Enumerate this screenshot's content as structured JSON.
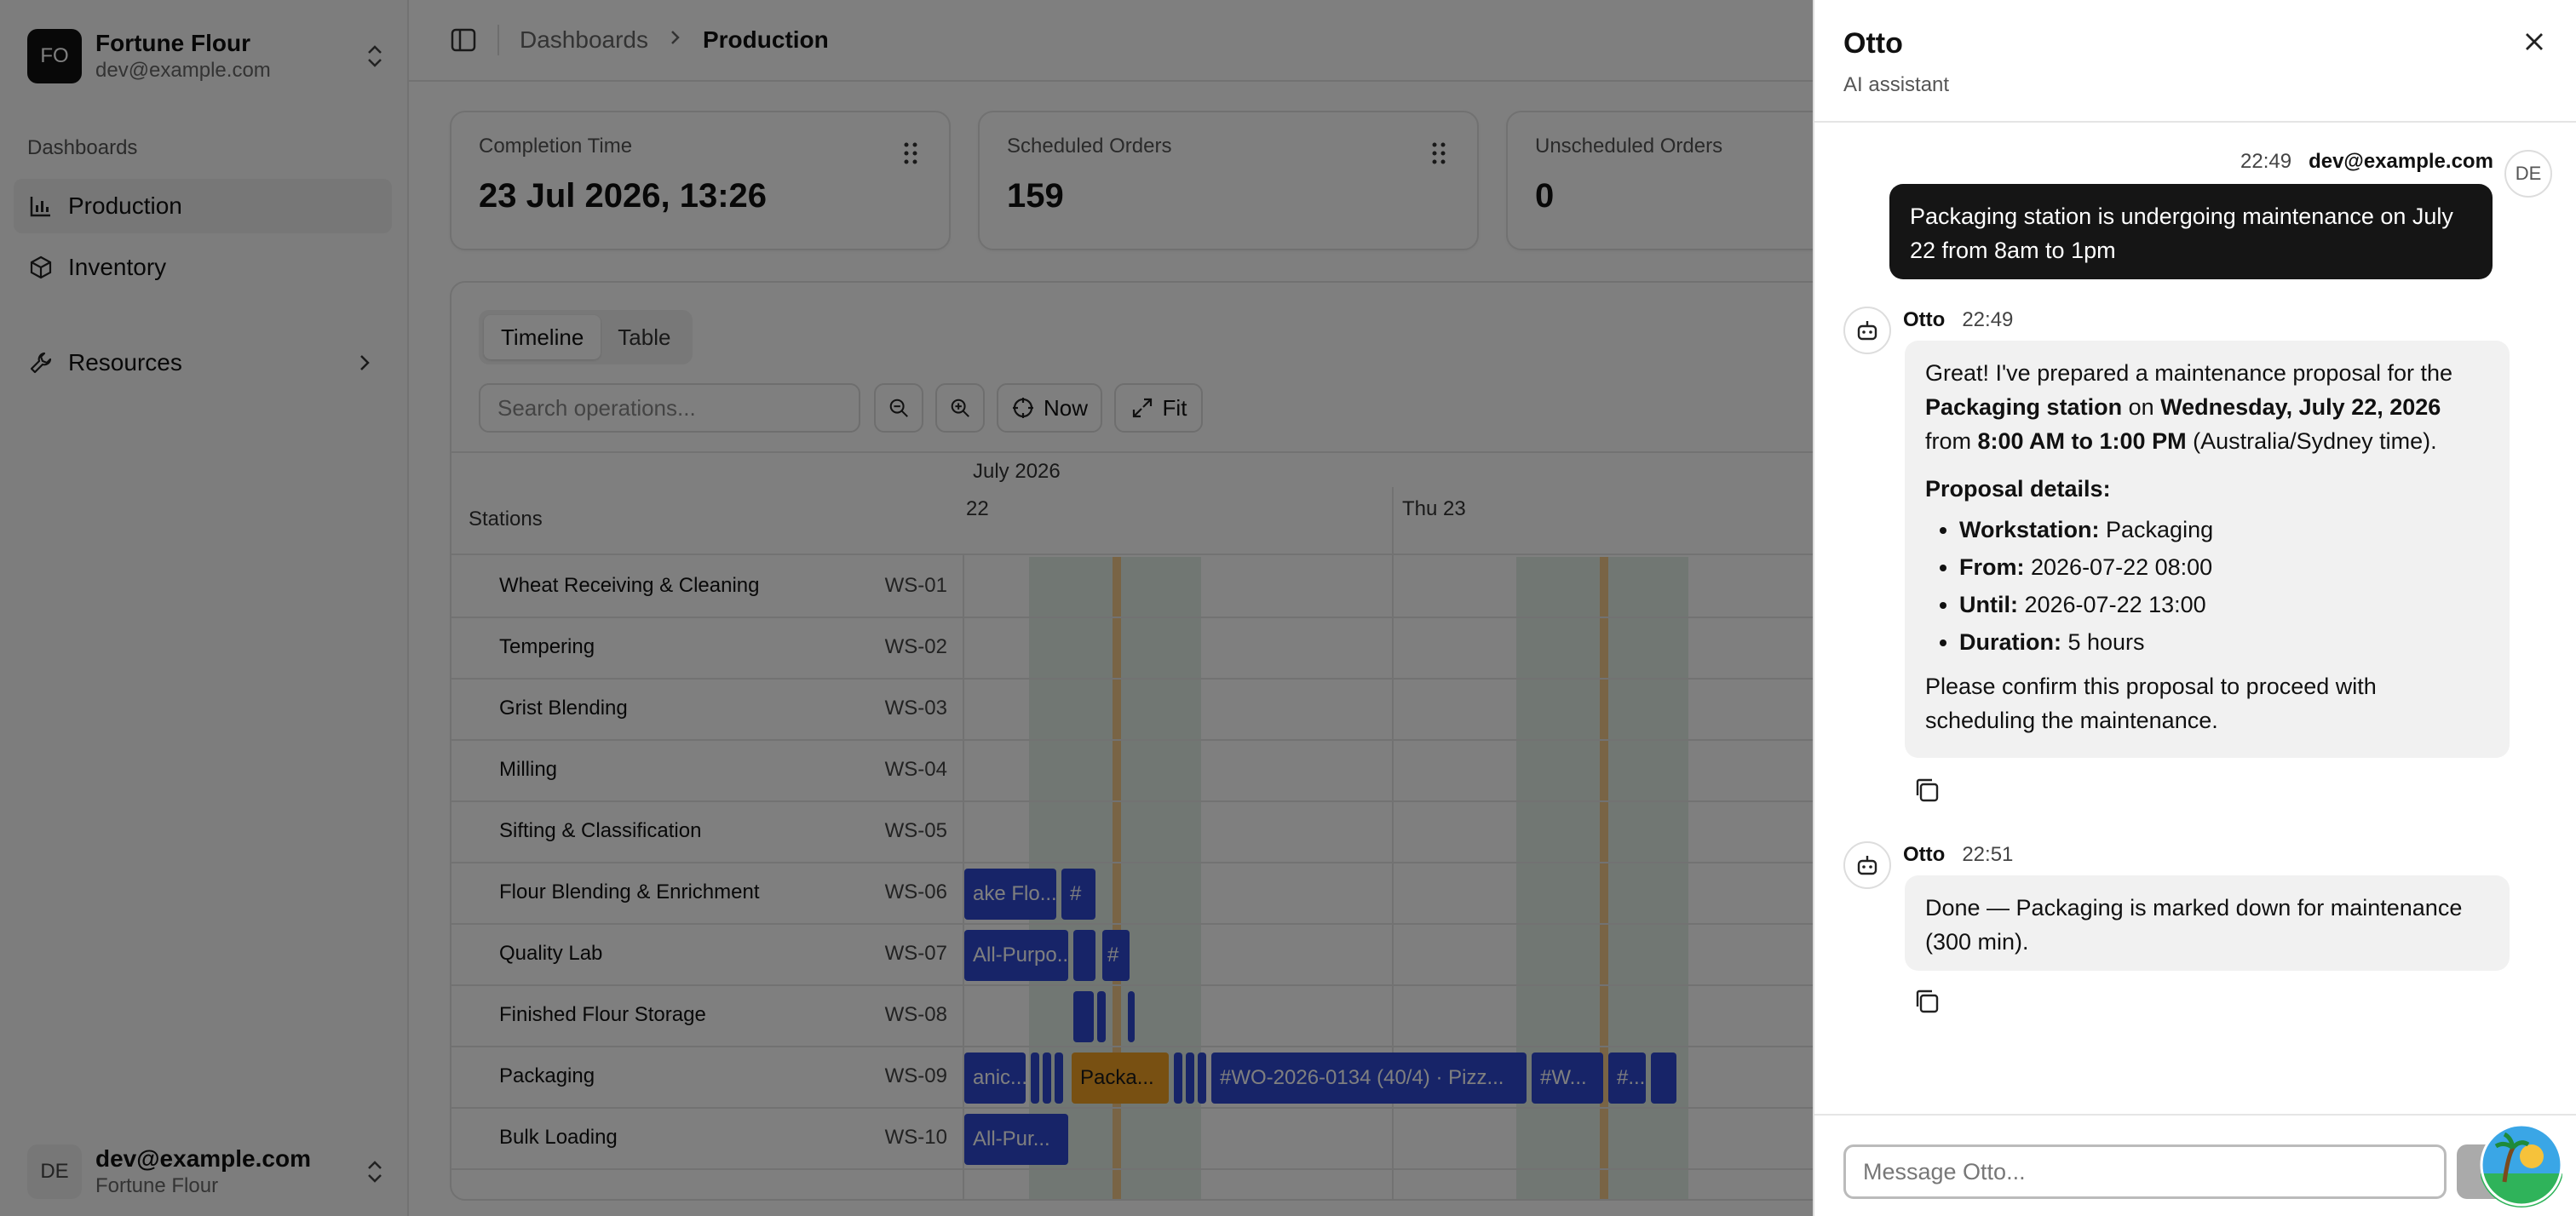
{
  "sidebar": {
    "team_initials": "FO",
    "team_name": "Fortune Flour",
    "team_email": "dev@example.com",
    "group_label": "Dashboards",
    "items": [
      {
        "label": "Production",
        "icon": "chart-icon",
        "active": true
      },
      {
        "label": "Inventory",
        "icon": "package-icon",
        "active": false
      },
      {
        "label": "Resources",
        "icon": "wrench-icon",
        "active": false
      }
    ],
    "user_initials": "DE",
    "user_email": "dev@example.com",
    "user_org": "Fortune Flour"
  },
  "breadcrumb": {
    "parent": "Dashboards",
    "current": "Production"
  },
  "stats": [
    {
      "label": "Completion Time",
      "value": "23 Jul 2026, 13:26"
    },
    {
      "label": "Scheduled Orders",
      "value": "159"
    },
    {
      "label": "Unscheduled Orders",
      "value": "0"
    }
  ],
  "board": {
    "view_tabs": [
      "Timeline",
      "Table"
    ],
    "active_tab": "Timeline",
    "search_placeholder": "Search operations...",
    "now_label": "Now",
    "fit_label": "Fit",
    "stations_header": "Stations",
    "month": "July 2026",
    "days": [
      "22",
      "Thu 23"
    ],
    "stations": [
      {
        "name": "Wheat Receiving & Cleaning",
        "code": "WS-01"
      },
      {
        "name": "Tempering",
        "code": "WS-02"
      },
      {
        "name": "Grist Blending",
        "code": "WS-03"
      },
      {
        "name": "Milling",
        "code": "WS-04"
      },
      {
        "name": "Sifting & Classification",
        "code": "WS-05"
      },
      {
        "name": "Flour Blending & Enrichment",
        "code": "WS-06"
      },
      {
        "name": "Quality Lab",
        "code": "WS-07"
      },
      {
        "name": "Finished Flour Storage",
        "code": "WS-08"
      },
      {
        "name": "Packaging",
        "code": "WS-09"
      },
      {
        "name": "Bulk Loading",
        "code": "WS-10"
      }
    ],
    "bars": {
      "ws06_a": "ake Flo...",
      "ws06_b": "#",
      "ws07_a": "All-Purpo...",
      "ws07_b": "#",
      "ws09_a": "anic...",
      "ws09_maint": "Packa...",
      "ws09_b": "#WO-2026-0134 (40/4) · Pizz...",
      "ws09_c": "#W...",
      "ws09_d": "#...",
      "ws10_a": "All-Pur..."
    }
  },
  "chat": {
    "title": "Otto",
    "subtitle": "AI assistant",
    "user_msg": {
      "time": "22:49",
      "author": "dev@example.com",
      "avatar": "DE",
      "text": "Packaging station is undergoing maintenance on July 22 from 8am to 1pm"
    },
    "bot_msg1": {
      "author": "Otto",
      "time": "22:49",
      "p1_a": "Great! I've prepared a maintenance proposal for the ",
      "p1_b": "Packaging station",
      "p1_c": " on ",
      "p1_d": "Wednesday, July 22, 2026",
      "p1_e": " from ",
      "p1_f": "8:00 AM to 1:00 PM",
      "p1_g": " (Australia/Sydney time).",
      "details_heading": "Proposal details:",
      "details": [
        {
          "k": "Workstation:",
          "v": " Packaging"
        },
        {
          "k": "From:",
          "v": " 2026-07-22 08:00"
        },
        {
          "k": "Until:",
          "v": " 2026-07-22 13:00"
        },
        {
          "k": "Duration:",
          "v": " 5 hours"
        }
      ],
      "closing": "Please confirm this proposal to proceed with scheduling the maintenance."
    },
    "bot_msg2": {
      "author": "Otto",
      "time": "22:51",
      "text": "Done — Packaging is marked down for maintenance (300 min)."
    },
    "composer_placeholder": "Message Otto..."
  },
  "colors": {
    "gantt_bar": "#2f49d1",
    "maintenance_bar": "#f0a024",
    "working_hours": "#e3efe6",
    "user_bubble": "#151515",
    "bot_bubble": "#f1f1f1"
  }
}
